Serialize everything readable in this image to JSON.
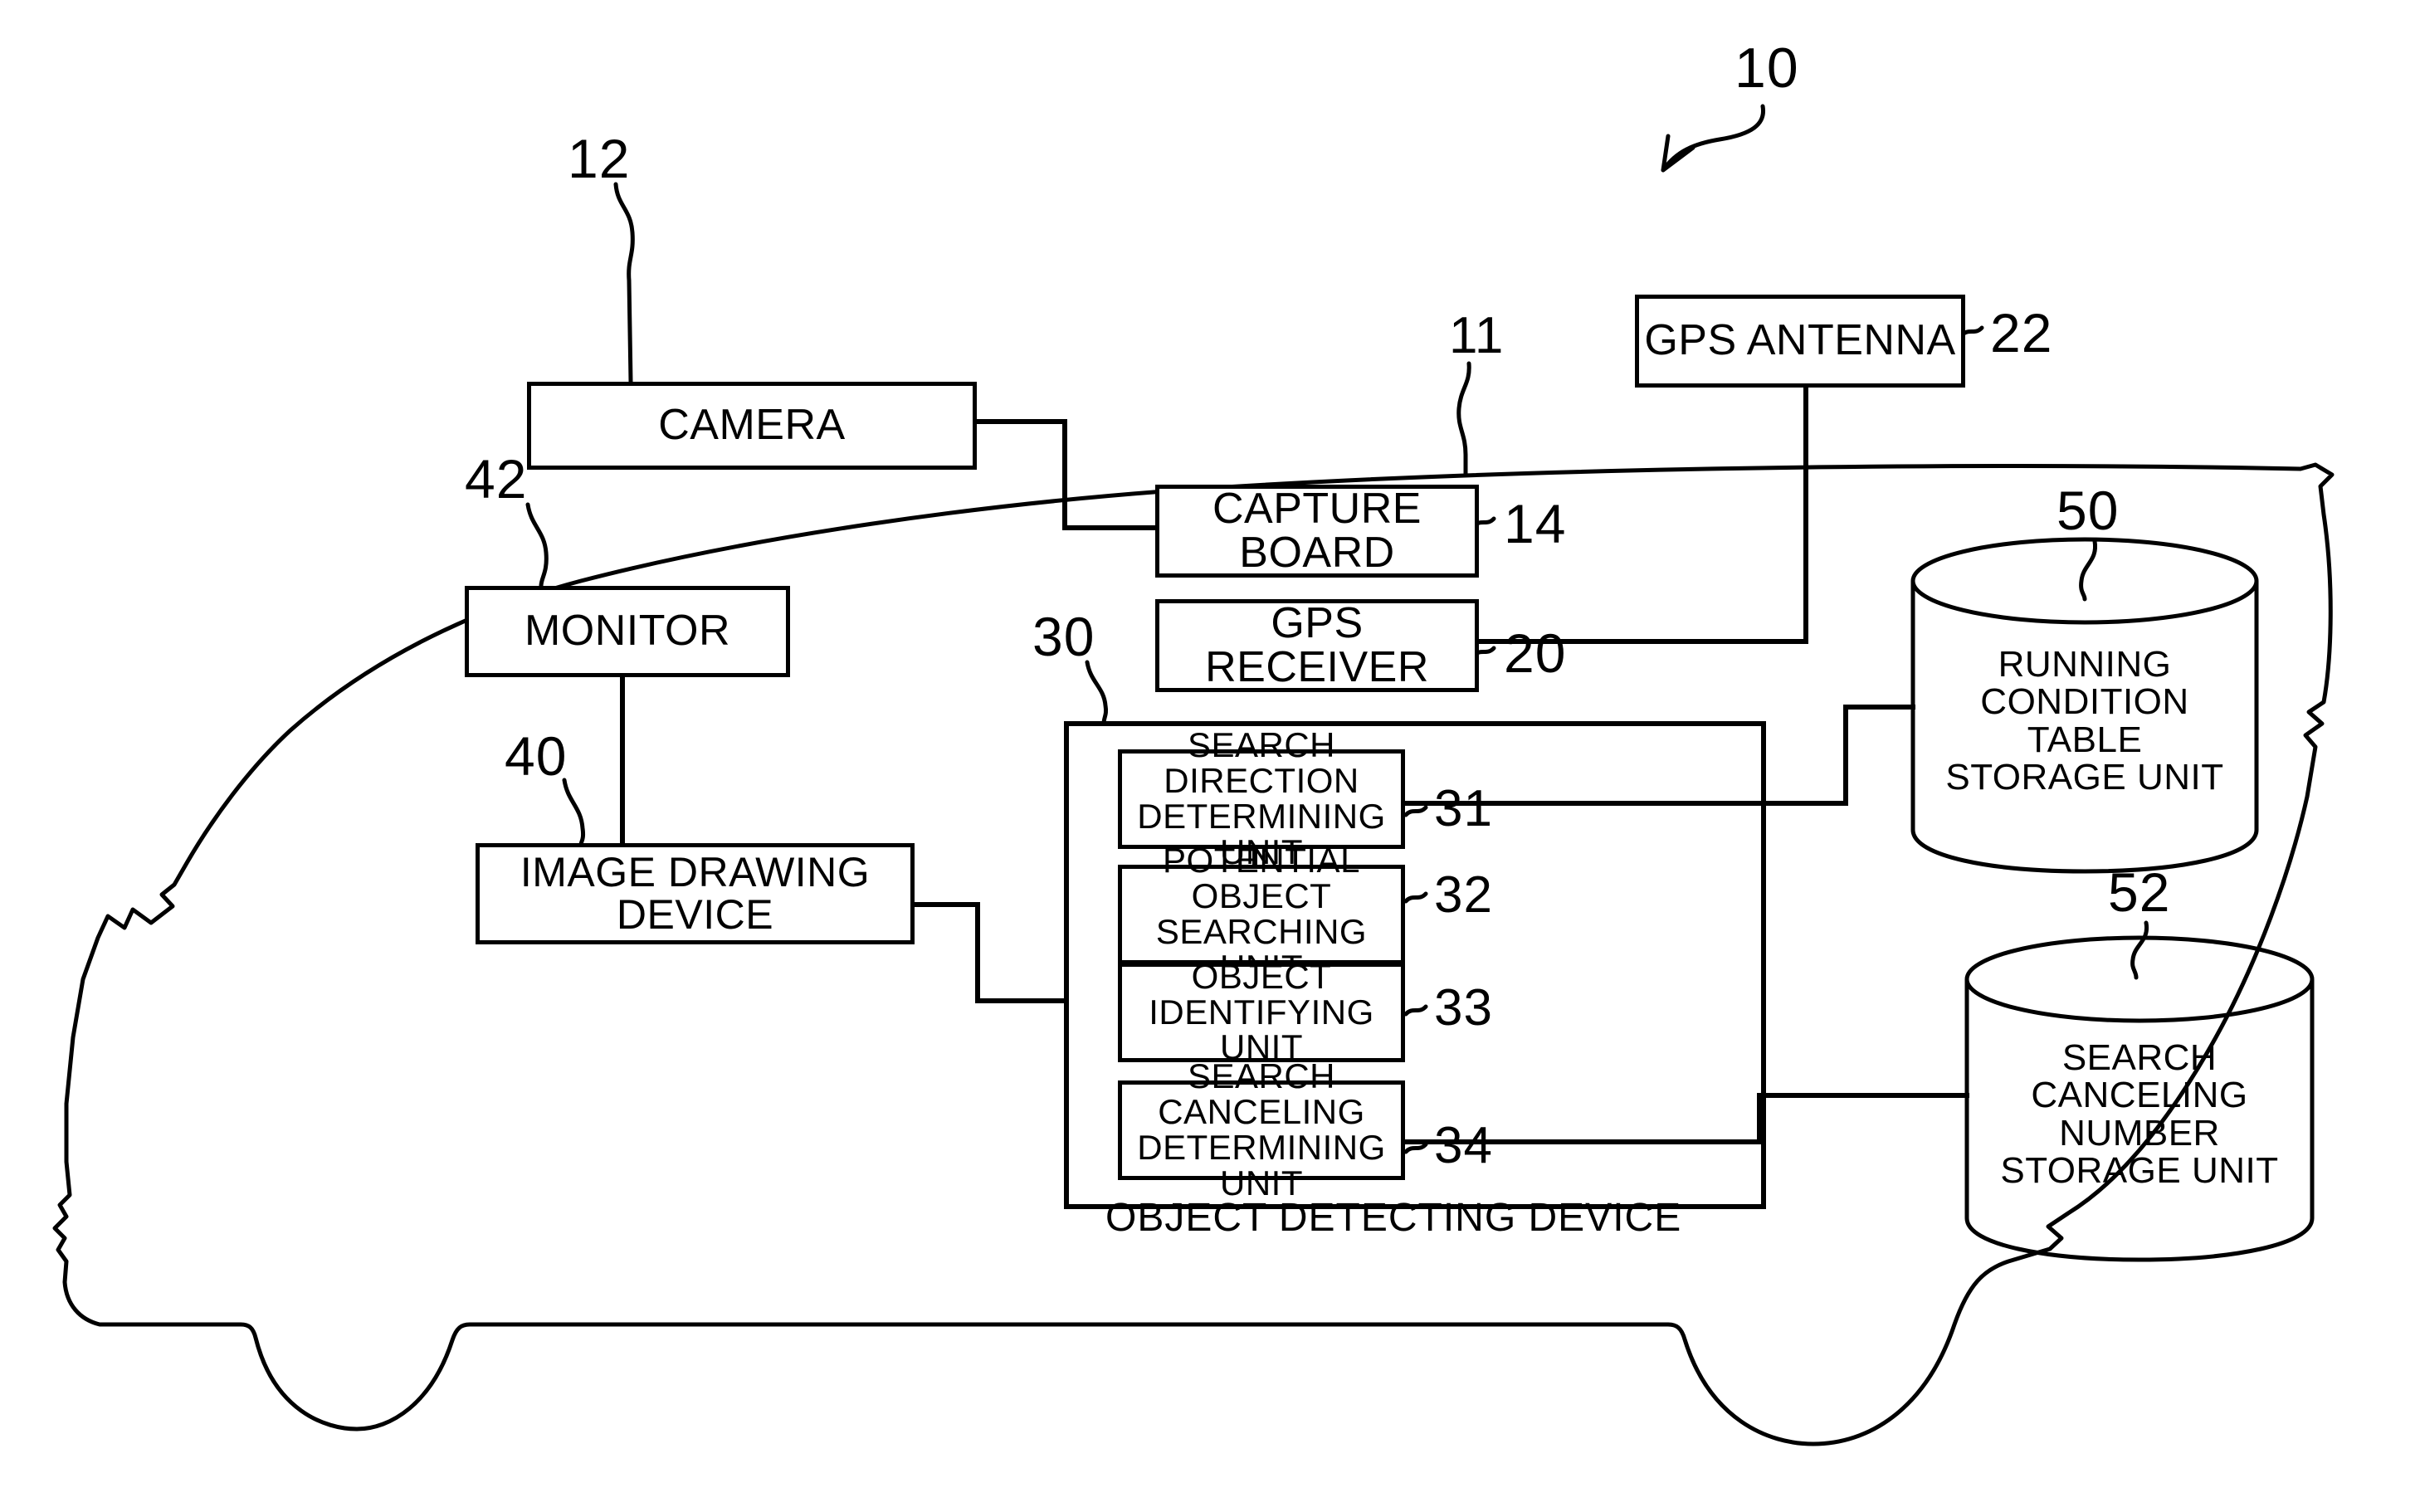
{
  "figure": {
    "type": "patent-block-diagram",
    "system_ref": "10",
    "vehicle_ref": "11"
  },
  "blocks": [
    {
      "id": "camera",
      "label": "CAMERA",
      "ref": "12"
    },
    {
      "id": "capture_board",
      "label": "CAPTURE BOARD",
      "ref": "14"
    },
    {
      "id": "gps_antenna",
      "label": "GPS ANTENNA",
      "ref": "22"
    },
    {
      "id": "gps_receiver",
      "label": "GPS RECEIVER",
      "ref": "20"
    },
    {
      "id": "monitor",
      "label": "MONITOR",
      "ref": "42"
    },
    {
      "id": "image_drawing",
      "label_line1": "IMAGE DRAWING",
      "label_line2": "DEVICE",
      "ref": "40"
    }
  ],
  "object_detecting_device": {
    "ref": "30",
    "caption": "OBJECT DETECTING DEVICE",
    "units": [
      {
        "id": "unit31",
        "line1": "SEARCH DIRECTION",
        "line2": "DETERMINING UNIT",
        "ref": "31"
      },
      {
        "id": "unit32",
        "line1": "POTENTIAL OBJECT",
        "line2": "SEARCHING UNIT",
        "ref": "32"
      },
      {
        "id": "unit33",
        "line1": "OBJECT",
        "line2": "IDENTIFYING UNIT",
        "ref": "33"
      },
      {
        "id": "unit34",
        "line1": "SEARCH CANCELING",
        "line2": "DETERMINING UNIT",
        "ref": "34"
      }
    ]
  },
  "storage_units": [
    {
      "id": "running_condition_table",
      "ref": "50",
      "lines": [
        "RUNNING",
        "CONDITION",
        "TABLE",
        "STORAGE UNIT"
      ]
    },
    {
      "id": "search_canceling_number",
      "ref": "52",
      "lines": [
        "SEARCH",
        "CANCELING",
        "NUMBER",
        "STORAGE UNIT"
      ]
    }
  ],
  "colors": {
    "ink": "#000000",
    "paper": "#ffffff"
  }
}
